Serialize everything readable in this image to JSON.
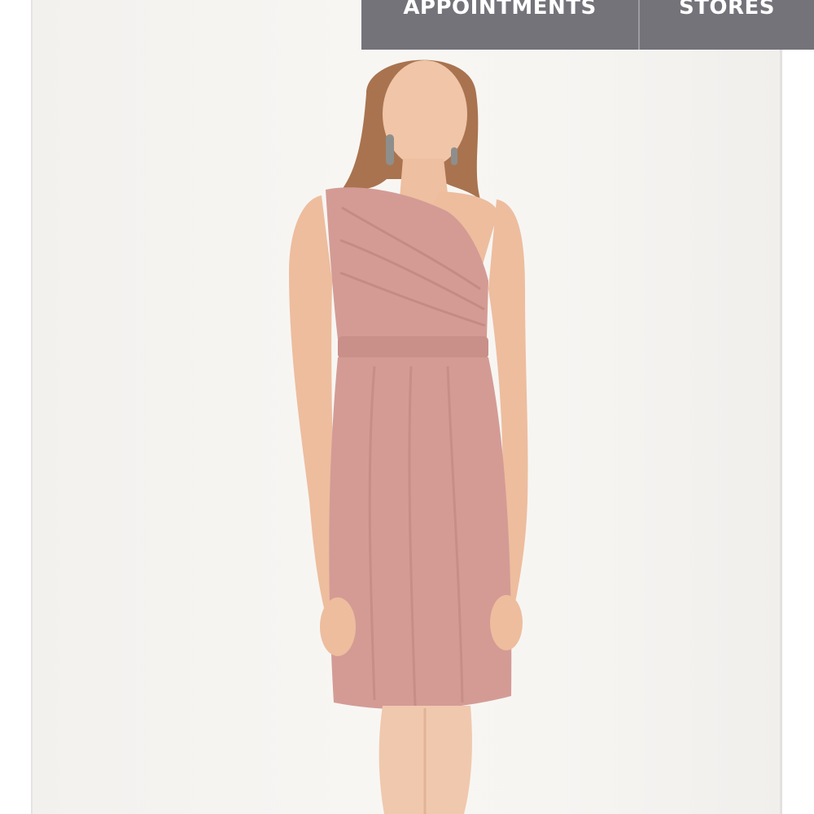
{
  "nav": {
    "appointments_label": "APPOINTMENTS",
    "stores_label": "STORES",
    "bar_color": "#74737a"
  },
  "product": {
    "dress_color": "#d49b95",
    "background_color": "#f7f5f2"
  }
}
